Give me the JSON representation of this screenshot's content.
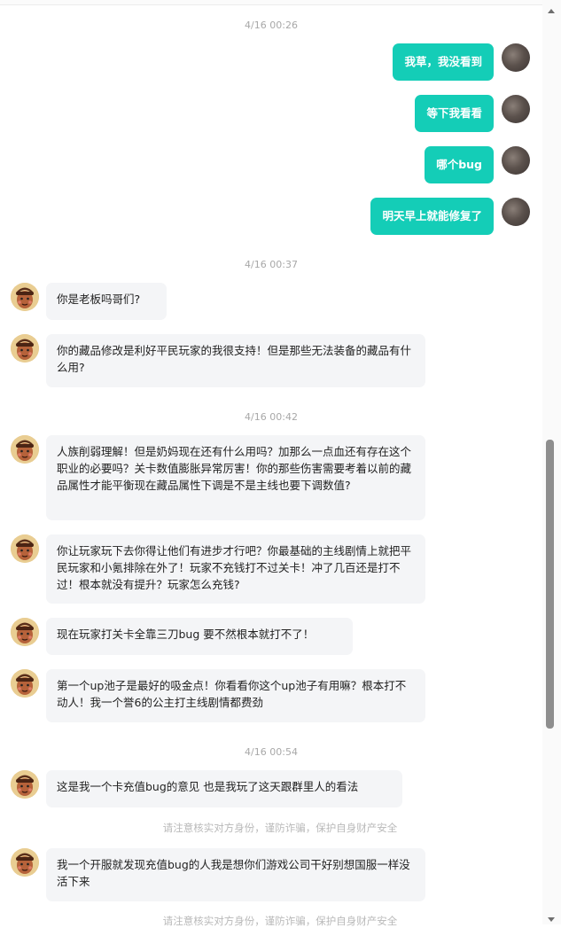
{
  "timestamps": [
    "4/16 00:26",
    "4/16 00:37",
    "4/16 00:42",
    "4/16 00:54"
  ],
  "outgoing": [
    {
      "text": "我草，我没看到"
    },
    {
      "text": "等下我看看"
    },
    {
      "text": "哪个bug"
    },
    {
      "text": "明天早上就能修复了"
    }
  ],
  "incoming": [
    {
      "text": "你是老板吗哥们?"
    },
    {
      "text": "你的藏品修改是利好平民玩家的我很支持！但是那些无法装备的藏品有什么用?"
    },
    {
      "text": "人族削弱理解！但是奶妈现在还有什么用吗？加那么一点血还有存在这个职业的必要吗？关卡数值膨胀异常厉害！你的那些伤害需要考着以前的藏品属性才能平衡现在藏品属性下调是不是主线也要下调数值?"
    },
    {
      "text": "你让玩家玩下去你得让他们有进步才行吧？你最基础的主线剧情上就把平民玩家和小氪排除在外了！玩家不充钱打不过关卡！冲了几百还是打不过！根本就没有提升？玩家怎么充钱?"
    },
    {
      "text": "现在玩家打关卡全靠三刀bug 要不然根本就打不了！"
    },
    {
      "text": "第一个up池子是最好的吸金点！你看看你这个up池子有用嘛？根本打不动人！我一个誉6的公主打主线剧情都费劲"
    },
    {
      "text": "这是我一个卡充值bug的意见 也是我玩了这天跟群里人的看法"
    },
    {
      "text": "我一个开服就发现充值bug的人我是想你们游戏公司干好别想国服一样没活下来"
    }
  ],
  "warnings": [
    "请注意核实对方身份，谨防诈骗，保护自身财产安全",
    "请注意核实对方身份，谨防诈骗，保护自身财产安全"
  ],
  "colors": {
    "accent": "#14cdb7",
    "incoming_bg": "#f4f5f7",
    "timestamp": "#a8a8a8"
  },
  "icons": {
    "scroll_up": "triangle-up",
    "scroll_down": "triangle-down"
  }
}
